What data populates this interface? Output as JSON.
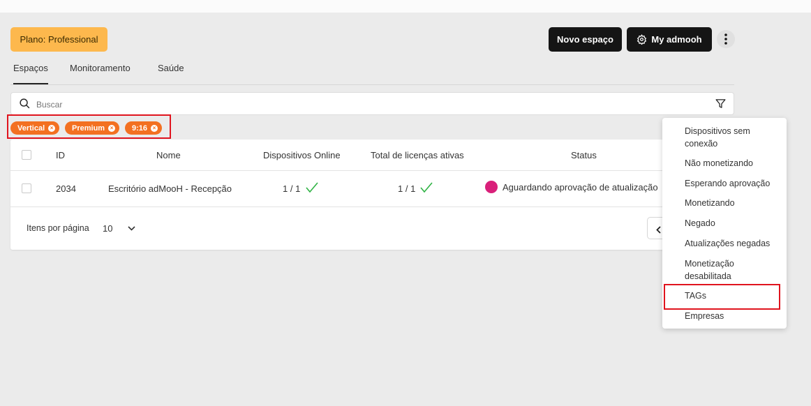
{
  "plan": {
    "label": "Plano: Professional",
    "color": "#fdb84d"
  },
  "header": {
    "new_space_label": "Novo espaço",
    "account_label": "My admooh",
    "account_icon": "gear-icon",
    "more_icon": "more-vertical-icon"
  },
  "tabs": [
    {
      "label": "Espaços",
      "active": true
    },
    {
      "label": "Monitoramento",
      "active": false
    },
    {
      "label": "Saúde",
      "active": false
    }
  ],
  "search": {
    "placeholder": "Buscar",
    "value": "",
    "filter_icon": "filter-icon"
  },
  "filters": {
    "chips": [
      {
        "label": "Vertical"
      },
      {
        "label": "Premium"
      },
      {
        "label": "9:16"
      }
    ],
    "chip_color": "#f37021"
  },
  "table": {
    "columns": [
      "ID",
      "Nome",
      "Dispositivos Online",
      "Total de licenças ativas",
      "Status"
    ],
    "rows": [
      {
        "id": "2034",
        "name": "Escritório adMooH - Recepção",
        "devices_online": "1 / 1",
        "licenses": "1 / 1",
        "status": "Aguardando aprovação de atualização",
        "status_color": "#d9207a"
      }
    ],
    "footer": {
      "items_per_page_label": "Itens por página",
      "items_per_page_value": "10"
    }
  },
  "status_menu": {
    "items": [
      "Dispositivos sem conexão",
      "Não monetizando",
      "Esperando aprovação",
      "Monetizando",
      "Negado",
      "Atualizações negadas",
      "Monetização desabilitada",
      "TAGs",
      "Empresas"
    ],
    "highlighted": "TAGs"
  },
  "colors": {
    "highlight_border": "#e0141e",
    "check_green": "#2fb344",
    "dark_button": "#151515"
  }
}
